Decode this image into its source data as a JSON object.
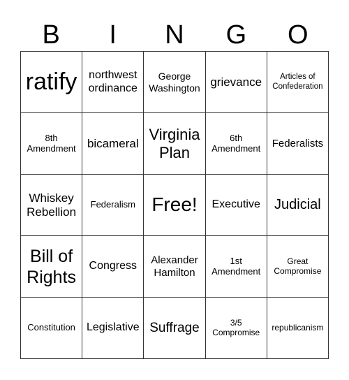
{
  "header": {
    "letters": [
      "B",
      "I",
      "N",
      "G",
      "O"
    ]
  },
  "board": {
    "rows": [
      [
        "ratify",
        "northwest ordinance",
        "George Washington",
        "grievance",
        "Articles of Confederation"
      ],
      [
        "8th Amendment",
        "bicameral",
        "Virginia Plan",
        "6th Amendment",
        "Federalists"
      ],
      [
        "Whiskey Rebellion",
        "Federalism",
        "Free!",
        "Executive",
        "Judicial"
      ],
      [
        "Bill of Rights",
        "Congress",
        "Alexander Hamilton",
        "1st Amendment",
        "Great Compromise"
      ],
      [
        "Constitution",
        "Legislative",
        "Suffrage",
        "3/5 Compromise",
        "republicanism"
      ]
    ]
  }
}
